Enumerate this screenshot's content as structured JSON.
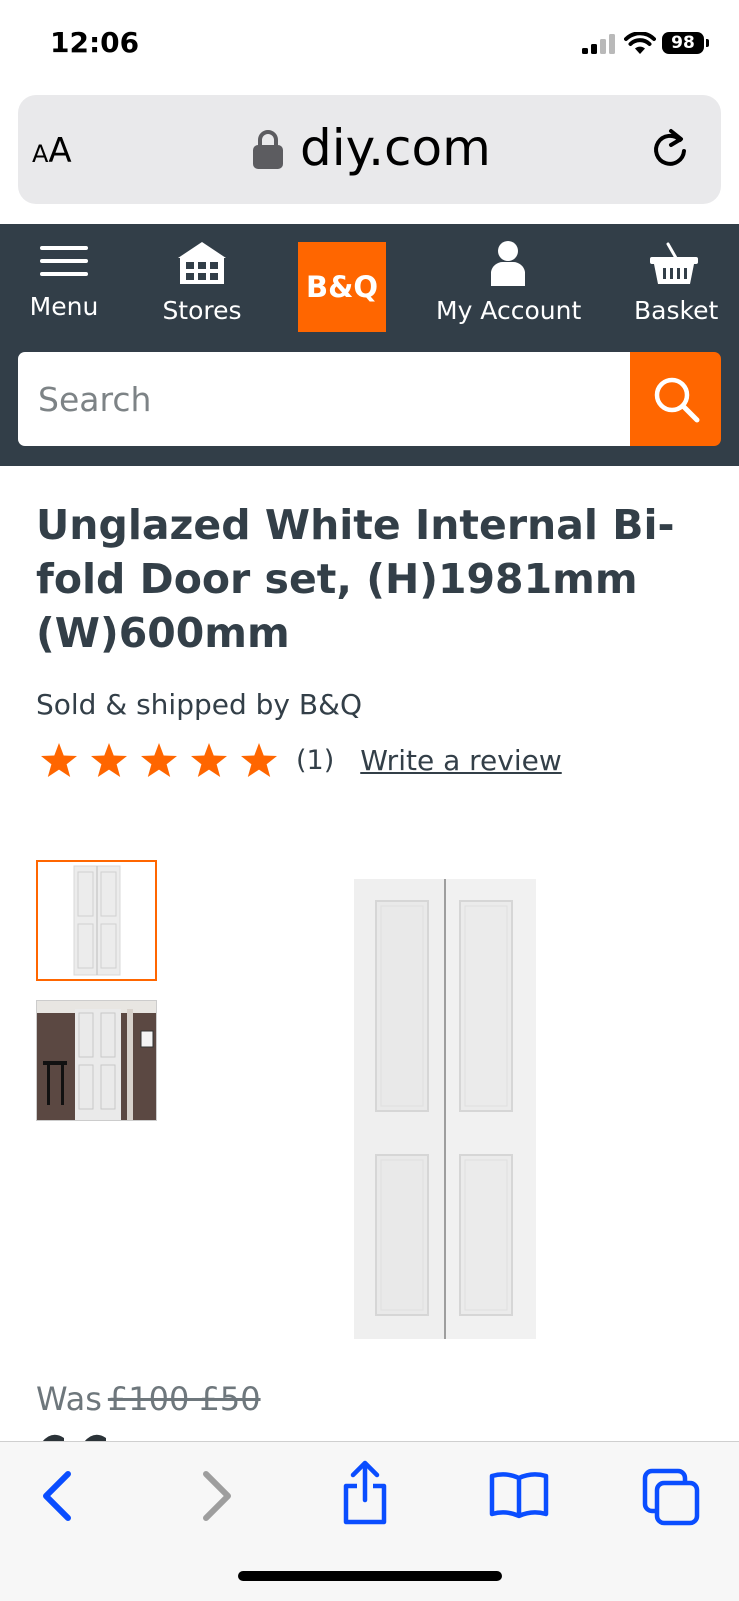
{
  "status": {
    "time": "12:06",
    "battery": "98"
  },
  "browser": {
    "text_size_small": "A",
    "text_size_large": "A",
    "domain": "diy.com"
  },
  "header": {
    "menu_label": "Menu",
    "stores_label": "Stores",
    "logo_text": "B&Q",
    "account_label": "My Account",
    "basket_label": "Basket",
    "search_placeholder": "Search"
  },
  "product": {
    "title": "Unglazed White Internal Bi-fold Door set, (H)1981mm (W)600mm",
    "seller": "Sold & shipped by B&Q",
    "rating": 5,
    "review_count": "(1)",
    "write_review": "Write a review",
    "was_label": "Was",
    "was_prices": "£100 £50"
  },
  "colors": {
    "brand": "#ff6600",
    "header": "#323e48",
    "text": "#333f48",
    "ios_blue": "#0a4dff"
  }
}
